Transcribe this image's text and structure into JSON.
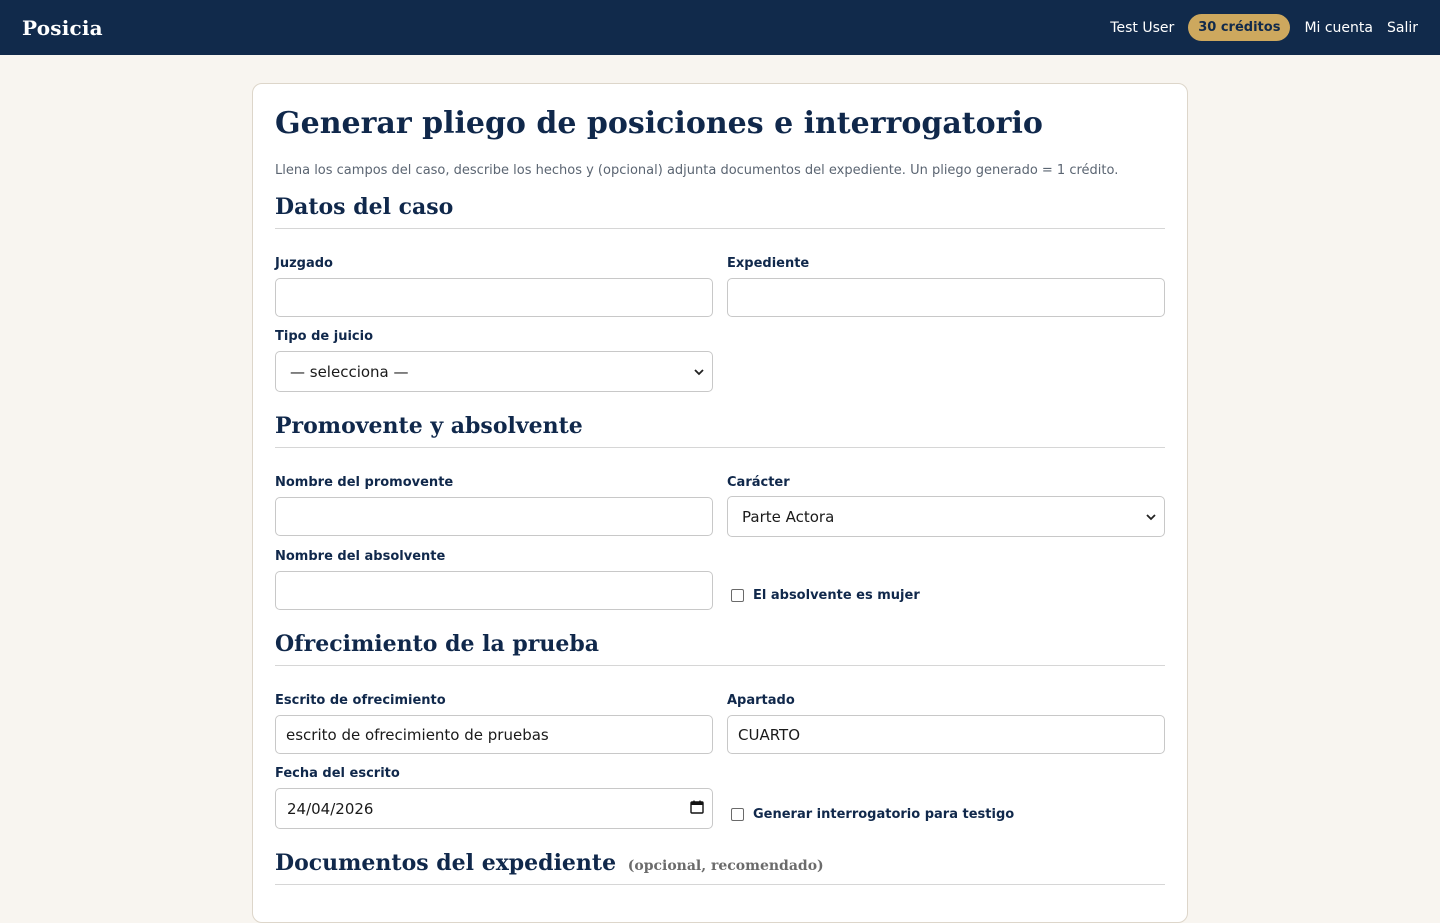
{
  "header": {
    "brand": "Posicia",
    "user": "Test User",
    "credits": "30 créditos",
    "account_link": "Mi cuenta",
    "logout_link": "Salir"
  },
  "page": {
    "title": "Generar pliego de posiciones e interrogatorio",
    "intro": "Llena los campos del caso, describe los hechos y (opcional) adjunta documentos del expediente. Un pliego generado = 1 crédito."
  },
  "sections": {
    "case": {
      "title": "Datos del caso",
      "juzgado_label": "Juzgado",
      "juzgado_value": "",
      "expediente_label": "Expediente",
      "expediente_value": "",
      "tipo_label": "Tipo de juicio",
      "tipo_value": "— selecciona —"
    },
    "parties": {
      "title": "Promovente y absolvente",
      "promovente_label": "Nombre del promovente",
      "promovente_value": "",
      "caracter_label": "Carácter",
      "caracter_value": "Parte Actora",
      "absolvente_label": "Nombre del absolvente",
      "absolvente_value": "",
      "mujer_label": "El absolvente es mujer",
      "mujer_checked": false
    },
    "evidence": {
      "title": "Ofrecimiento de la prueba",
      "escrito_label": "Escrito de ofrecimiento",
      "escrito_value": "escrito de ofrecimiento de pruebas",
      "apartado_label": "Apartado",
      "apartado_value": "CUARTO",
      "fecha_label": "Fecha del escrito",
      "fecha_value": "24/04/2026",
      "testigo_label": "Generar interrogatorio para testigo",
      "testigo_checked": false
    },
    "documents": {
      "title": "Documentos del expediente",
      "subtitle": "(opcional, recomendado)"
    }
  },
  "icons": {
    "select_chevron": "chevron-down-icon",
    "date_picker": "calendar-icon",
    "checkbox": "checkbox-icon"
  },
  "colors": {
    "header_bg": "#112a4b",
    "accent_gold": "#cda85e",
    "page_bg": "#f8f5f0",
    "text_navy": "#10284b"
  }
}
